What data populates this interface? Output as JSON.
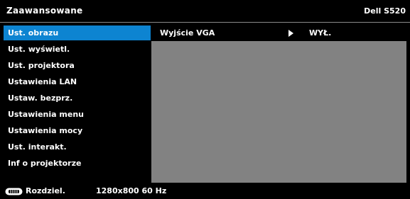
{
  "header": {
    "title": "Zaawansowane",
    "model": "Dell S520"
  },
  "sidebar": {
    "items": [
      {
        "label": "Ust. obrazu",
        "selected": true
      },
      {
        "label": "Ust. wyświetl.",
        "selected": false
      },
      {
        "label": "Ust. projektora",
        "selected": false
      },
      {
        "label": "Ustawienia LAN",
        "selected": false
      },
      {
        "label": "Ustaw. bezprz.",
        "selected": false
      },
      {
        "label": "Ustawienia menu",
        "selected": false
      },
      {
        "label": "Ustawienia mocy",
        "selected": false
      },
      {
        "label": "Ust. interakt.",
        "selected": false
      },
      {
        "label": "Inf o projektorze",
        "selected": false
      }
    ]
  },
  "content": {
    "setting_label": "Wyjście VGA",
    "setting_value": "WYŁ.",
    "arrow_icon": "right-triangle-icon"
  },
  "status": {
    "icon": "resolution-icon",
    "label": "Rozdziel.",
    "value": "1280x800 60 Hz"
  },
  "colors": {
    "background": "#000000",
    "selected": "#0d84d1",
    "content_panel": "#828282",
    "text": "#ffffff"
  }
}
